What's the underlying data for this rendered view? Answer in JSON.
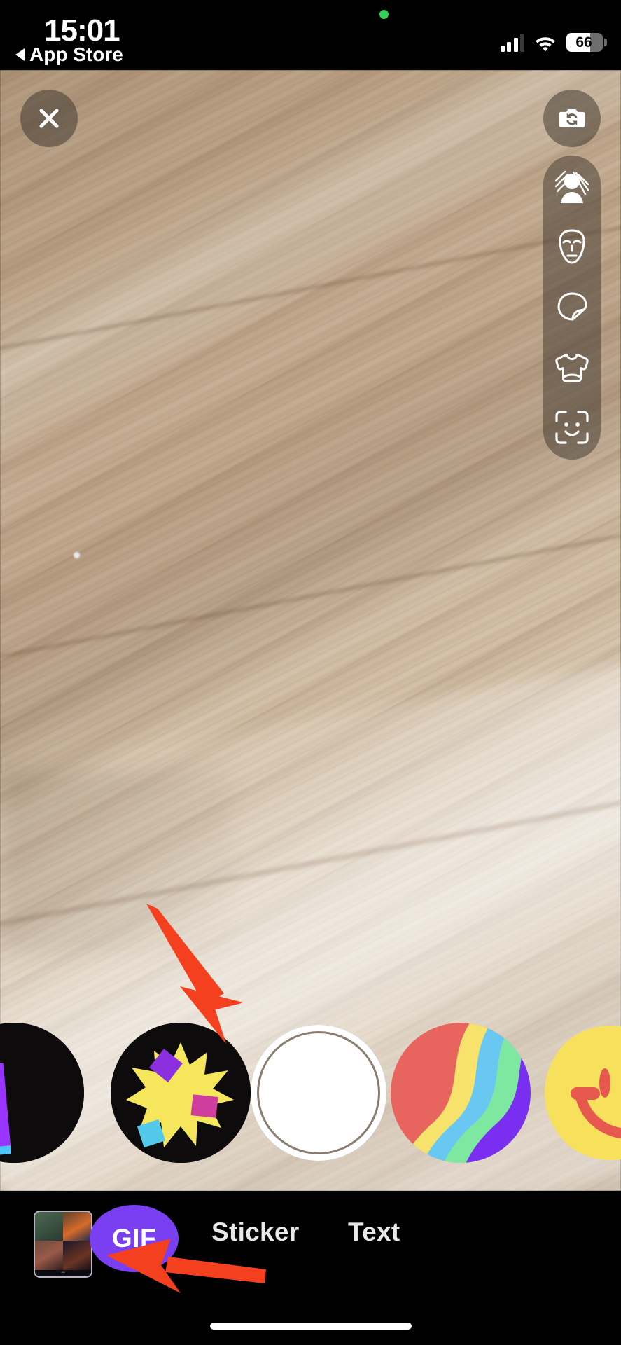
{
  "status_bar": {
    "time": "15:01",
    "back_label": "App Store",
    "back_icon": "triangle-left-icon",
    "recording_dot_icon": "green-recording-dot-icon",
    "recording_dot_color": "#30d158",
    "cellular_icon": "cellular-signal-icon",
    "cellular_bars_filled": 3,
    "cellular_bars_total": 4,
    "wifi_icon": "wifi-icon",
    "battery_icon": "battery-icon",
    "battery_percent": "66",
    "battery_level": 66
  },
  "viewfinder": {
    "scene_description": "wood floor",
    "close_button": {
      "icon": "close-x-icon",
      "label": "Close"
    },
    "flip_camera_button": {
      "icon": "camera-flip-icon",
      "label": "Flip camera"
    },
    "effects_rail": [
      {
        "icon": "portrait-effect-icon",
        "label": "Portrait"
      },
      {
        "icon": "face-mask-icon",
        "label": "Masks"
      },
      {
        "icon": "sticker-leaf-icon",
        "label": "Effects"
      },
      {
        "icon": "tshirt-icon",
        "label": "Backdrops"
      },
      {
        "icon": "face-scan-smile-icon",
        "label": "Memoji"
      }
    ]
  },
  "annotations": {
    "color": "#F4401F",
    "arrows": [
      {
        "name": "arrow-to-shutter",
        "points_to": "shutter-button",
        "direction": "down-right"
      },
      {
        "name": "arrow-to-gif",
        "points_to": "gif-tab",
        "direction": "left"
      }
    ]
  },
  "carousel": {
    "name": "effect-filter-carousel",
    "items": [
      {
        "id": "purple-card-filter",
        "label": "Purple card effect",
        "bg": "#0d0b0c",
        "colors": [
          "#9933ff",
          "#e8478f",
          "#4fc3f7"
        ]
      },
      {
        "id": "comic-burst-filter",
        "label": "Comic burst effect",
        "bg": "#0d0b0c",
        "colors": [
          "#f5e65c",
          "#8b2fe0",
          "#cf3d9e",
          "#52c9ea"
        ]
      },
      {
        "id": "shutter-button",
        "label": "Capture",
        "bg": "#ffffff",
        "colors": []
      },
      {
        "id": "rainbow-swirl-filter",
        "label": "Rainbow swirl effect",
        "bg": "transparent",
        "colors": [
          "#e7655e",
          "#f7e26b",
          "#68c8f2",
          "#7fe8a0",
          "#7a2ff0"
        ]
      },
      {
        "id": "smiley-filter",
        "label": "Smiley effect",
        "bg": "transparent",
        "colors": [
          "#f7e15c",
          "#e7594f",
          "#4a53d8"
        ]
      }
    ],
    "selected_index": 2
  },
  "tab_bar": {
    "media_thumbnail": {
      "name": "media-thumbnail",
      "label": "Recent media"
    },
    "tabs": [
      {
        "id": "gif",
        "label": "GIF",
        "active": true,
        "accent": "#7b3ff2"
      },
      {
        "id": "sticker",
        "label": "Sticker",
        "active": false
      },
      {
        "id": "text",
        "label": "Text",
        "active": false
      }
    ]
  },
  "home_indicator": {
    "name": "home-indicator"
  }
}
